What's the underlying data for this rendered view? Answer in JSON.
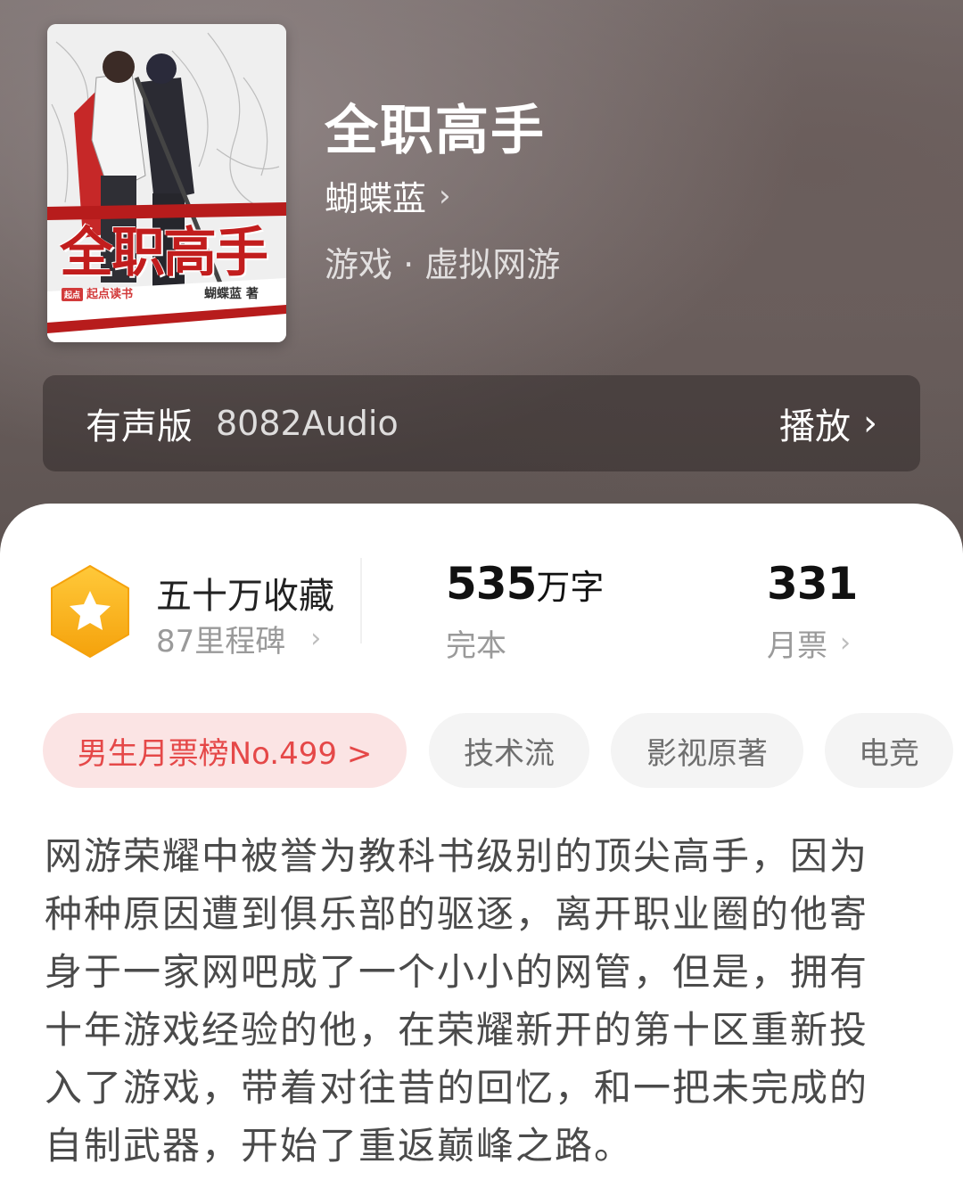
{
  "book": {
    "title": "全职高手",
    "author": "蝴蝶蓝",
    "author_chevron": "›",
    "genre": "游戏 · 虚拟网游",
    "cover": {
      "title": "全职高手",
      "publisher": "起点读书",
      "publisher_logo": "起点",
      "author_credit": "蝴蝶蓝 著"
    }
  },
  "audio": {
    "label": "有声版",
    "name": "8082Audio",
    "play_label": "播放",
    "chevron": "›"
  },
  "stats": {
    "collection": {
      "title": "五十万收藏",
      "milestone": "87里程碑",
      "chevron": "›",
      "badge_icon": "star-icon",
      "badge_color": "#f7b61d"
    },
    "words": {
      "number": "535",
      "unit": "万字",
      "status": "完本"
    },
    "monthly": {
      "number": "331",
      "label": "月票",
      "chevron": "›"
    }
  },
  "tags": [
    {
      "label": "男生月票榜No.499 >"
    },
    {
      "label": "技术流"
    },
    {
      "label": "影视原著"
    },
    {
      "label": "电竞"
    }
  ],
  "description": [
    "网游荣耀中被誉为教科书级别的顶尖高手，因为",
    "种种原因遭到俱乐部的驱逐，离开职业圈的他寄",
    "身于一家网吧成了一个小小的网管，但是，拥有",
    "十年游戏经验的他，在荣耀新开的第十区重新投",
    "入了游戏，带着对往昔的回忆，和一把未完成的",
    "自制武器，开始了重返巅峰之路。"
  ],
  "colors": {
    "rank_text": "#e54848",
    "rank_bg": "#fbe4e4",
    "tag_bg": "#f4f4f4"
  }
}
